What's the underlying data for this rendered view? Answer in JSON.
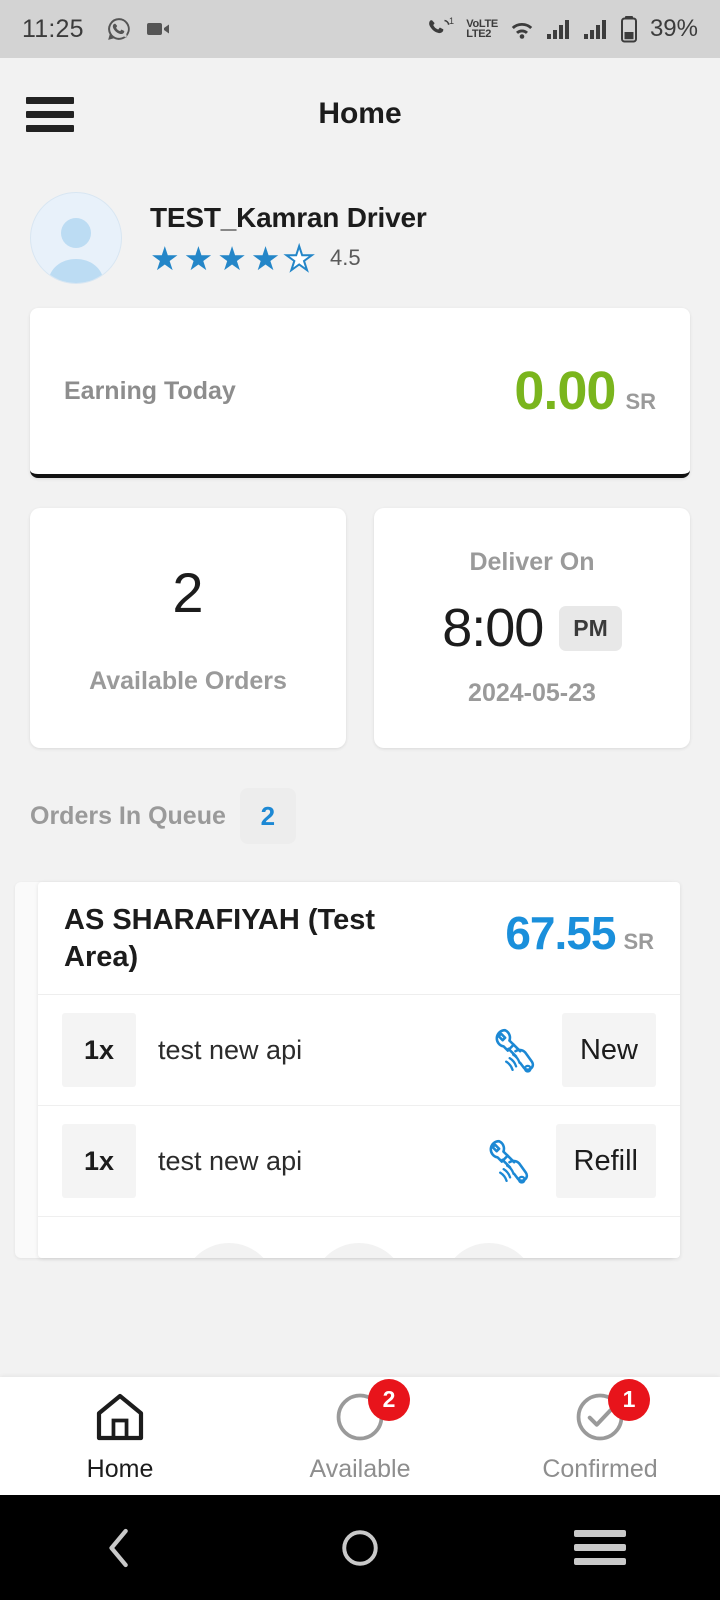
{
  "status_bar": {
    "time": "11:25",
    "left_icons": [
      "whatsapp-icon",
      "video-camera-icon"
    ],
    "call_badge": "1",
    "network_line1": "VoLTE",
    "network_line2": "LTE2",
    "right_icons": [
      "wifi-icon",
      "signal-sim1-icon",
      "signal-sim2-icon",
      "battery-icon"
    ],
    "battery": "39%"
  },
  "app_bar": {
    "menu_icon": "hamburger-menu-icon",
    "title": "Home"
  },
  "profile": {
    "avatar_icon": "user-avatar-placeholder-icon",
    "name": "TEST_Kamran Driver",
    "stars_filled": 4,
    "stars_total": 5,
    "rating": "4.5",
    "star_color": "#2486c8"
  },
  "earning": {
    "label": "Earning Today",
    "amount": "0.00",
    "currency": "SR",
    "amount_color": "#7ab51d"
  },
  "stats": {
    "available": {
      "count": "2",
      "label": "Available Orders"
    },
    "deliver": {
      "label": "Deliver On",
      "time": "8:00",
      "ampm": "PM",
      "date": "2024-05-23"
    }
  },
  "queue": {
    "label": "Orders In Queue",
    "count": "2",
    "count_color": "#1c88d4"
  },
  "order": {
    "title": "AS SHARAFIYAH  (Test Area)",
    "price": "67.55",
    "currency": "SR",
    "price_color": "#1a8fdb",
    "items": [
      {
        "qty": "1x",
        "name": "test new api",
        "icon": "hand-wrench-service-icon",
        "tag": "New"
      },
      {
        "qty": "1x",
        "name": "test new api",
        "icon": "hand-wrench-service-icon",
        "tag": "Refill"
      }
    ],
    "contact_actions": [
      {
        "icon": "phone-icon",
        "name": "call-button"
      },
      {
        "icon": "mail-envelope-icon",
        "name": "email-button"
      },
      {
        "icon": "store-shop-icon",
        "name": "store-button"
      }
    ]
  },
  "bottom_nav": {
    "items": [
      {
        "label": "Home",
        "icon": "home-icon",
        "active": true,
        "badge": ""
      },
      {
        "label": "Available",
        "icon": "circle-outline-icon",
        "active": false,
        "badge": "2"
      },
      {
        "label": "Confirmed",
        "icon": "check-circle-icon",
        "active": false,
        "badge": "1"
      }
    ],
    "badge_color": "#e8141b"
  },
  "android_nav": {
    "back_icon": "back-chevron-icon",
    "home_icon": "home-circle-icon",
    "recents_icon": "recents-menu-icon"
  }
}
